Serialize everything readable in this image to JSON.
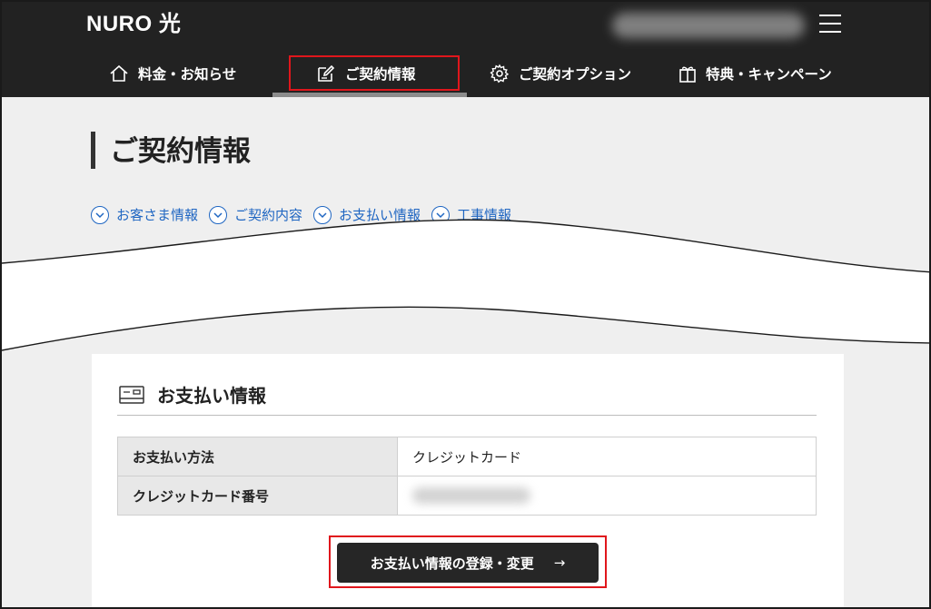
{
  "header": {
    "logo": "NURO 光",
    "nav": [
      {
        "label": "料金・お知らせ",
        "icon": "home-icon"
      },
      {
        "label": "ご契約情報",
        "icon": "edit-document-icon",
        "active": true
      },
      {
        "label": "ご契約オプション",
        "icon": "gear-icon"
      },
      {
        "label": "特典・キャンペーン",
        "icon": "gift-icon"
      }
    ]
  },
  "page": {
    "title": "ご契約情報",
    "anchors": [
      "お客さま情報",
      "ご契約内容",
      "お支払い情報",
      "工事情報"
    ]
  },
  "payment": {
    "title": "お支払い情報",
    "rows": [
      {
        "label": "お支払い方法",
        "value": "クレジットカード"
      },
      {
        "label": "クレジットカード番号",
        "value": ""
      }
    ],
    "cta_label": "お支払い情報の登録・変更",
    "cta_arrow": "→"
  },
  "colors": {
    "header_bg": "#222222",
    "link": "#1f66c2",
    "highlight": "#e0161c"
  }
}
